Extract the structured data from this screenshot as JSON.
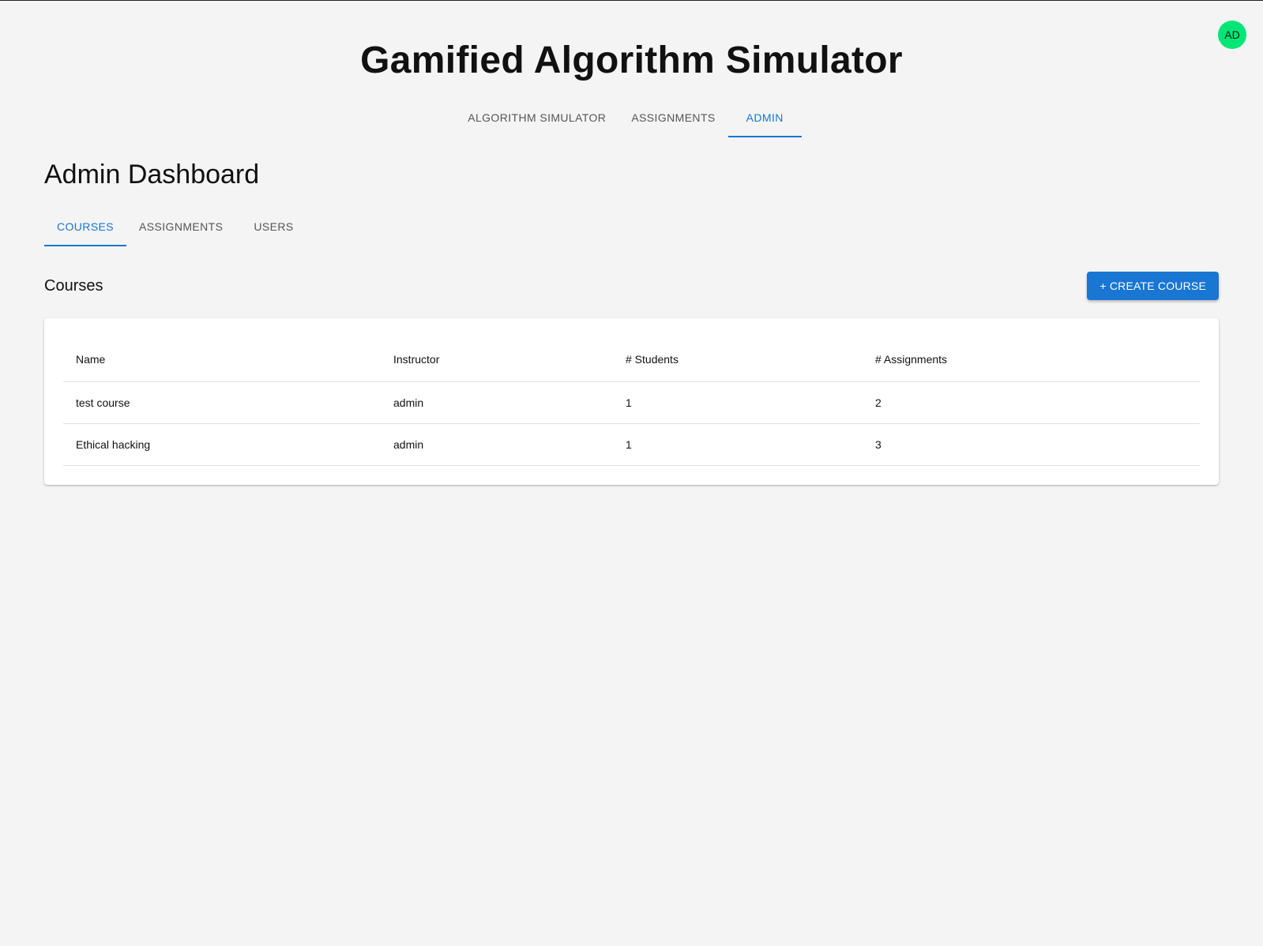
{
  "app": {
    "title": "Gamified Algorithm Simulator",
    "avatar_initials": "AD",
    "avatar_color": "#00e676"
  },
  "main_nav": {
    "tabs": [
      {
        "label": "ALGORITHM SIMULATOR",
        "active": false
      },
      {
        "label": "ASSIGNMENTS",
        "active": false
      },
      {
        "label": "ADMIN",
        "active": true
      }
    ]
  },
  "page": {
    "title": "Admin Dashboard"
  },
  "sub_tabs": [
    {
      "label": "COURSES",
      "active": true
    },
    {
      "label": "ASSIGNMENTS",
      "active": false
    },
    {
      "label": "USERS",
      "active": false
    }
  ],
  "courses": {
    "section_title": "Courses",
    "create_button_label": "+ CREATE COURSE",
    "table": {
      "headers": [
        "Name",
        "Instructor",
        "# Students",
        "# Assignments"
      ],
      "rows": [
        [
          "test course",
          "admin",
          "1",
          "2"
        ],
        [
          "Ethical hacking",
          "admin",
          "1",
          "3"
        ]
      ]
    }
  },
  "colors": {
    "accent": "#1976d2",
    "background": "#f4f4f4"
  }
}
